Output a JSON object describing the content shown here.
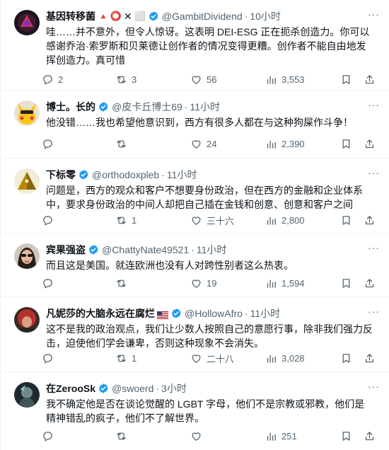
{
  "tweets": [
    {
      "name": "基因转移菌",
      "emojis": [
        "🔺",
        "⭕",
        "✕",
        "⬜"
      ],
      "handle": "@GambitDividend",
      "time": "10小时",
      "text": "哇……并不意外，但令人惊讶。这表明 DEI-ESG 正在扼杀创造力。你可以感谢乔治·索罗斯和贝莱德让创作者的情况变得更糟。创作者不能自由地发挥创造力。真可惜",
      "replies": "2",
      "retweets": "3",
      "likes": "56",
      "views": "3,553",
      "avatar_icon": "dark-red-emblem-avatar"
    },
    {
      "name": "博士。长的",
      "handle": "@皮卡丘博士69",
      "time": "11小时",
      "text": "他没错……我也希望他意识到，西方有很多人都在与这种狗屎作斗争！",
      "replies": "",
      "retweets": "",
      "likes": "24",
      "views": "2,390",
      "avatar_icon": "pikachu-avatar"
    },
    {
      "name": "下标零",
      "handle": "@orthodoxpleb",
      "time": "11小时",
      "text": "问题是，西方的观众和客户不想要身份政治，但在西方的金融和企业体系中，要求身份政治的中间人却把自己插在金钱和创意、创意和客户之间",
      "replies": "",
      "retweets": "1",
      "likes": "三十六",
      "views": "2,800",
      "avatar_icon": "pyramid-avatar"
    },
    {
      "name": "宾果强盗",
      "handle": "@ChattyNate49521",
      "time": "11小时",
      "text": "而且这是美国。就连欧洲也没有人对跨性别者这么热衷。",
      "replies": "",
      "retweets": "",
      "likes": "19",
      "views": "1,594",
      "avatar_icon": "woman-sunglasses-avatar"
    },
    {
      "name": "凡妮莎的大脑永远在腐烂",
      "handle": "@HollowAfro",
      "time": "11小时",
      "text": "这不是我的政治观点，我们让少数人按照自己的意愿行事，除非我们强力反击，迫使他们学会谦卑，否则这种现象不会消失。",
      "replies": "",
      "retweets": "1",
      "likes": "二十八",
      "views": "3,028",
      "avatar_icon": "red-hair-avatar"
    },
    {
      "name": "在ZerooSk",
      "handle": "@swoerd",
      "time": "3小时",
      "text": "我不确定他是否在谈论觉醒的 LGBT 字母，他们不是宗教或邪教，他们是精神错乱的疯子，他们不了解世界。",
      "replies": "",
      "retweets": "",
      "likes": "",
      "views": "251",
      "avatar_icon": "dark-character-avatar"
    }
  ],
  "colors": {
    "verified": "#1d9bf0",
    "muted": "#536471",
    "divider": "#eff3f4"
  },
  "more_label": "···"
}
